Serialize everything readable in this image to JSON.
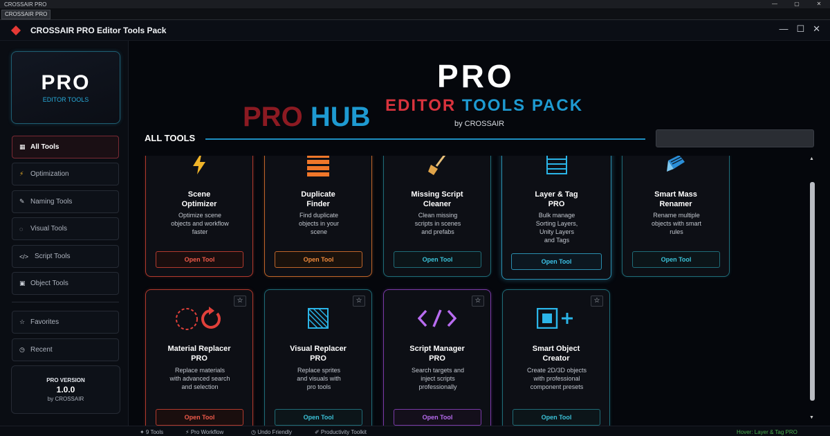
{
  "os": {
    "title": "CROSSAIR PRO",
    "tab": "CROSSAIR PRO",
    "minimize": "—",
    "maximize": "▢",
    "close": "✕"
  },
  "app": {
    "title": "CROSSAIR PRO Editor Tools Pack",
    "minimize": "—",
    "maximize": "☐",
    "close": "✕",
    "accent": "#e53935"
  },
  "sidebar": {
    "logo_big": "PRO",
    "logo_small": "EDITOR TOOLS",
    "items": [
      {
        "icon": "▦",
        "label": "All Tools"
      },
      {
        "icon": "⚡",
        "label": "Optimization"
      },
      {
        "icon": "✎",
        "label": "Naming Tools"
      },
      {
        "icon": "◌",
        "label": "Visual Tools"
      },
      {
        "icon": "</>",
        "label": "Script Tools"
      },
      {
        "icon": "▣",
        "label": "Object Tools"
      }
    ],
    "favorites": {
      "icon": "☆",
      "label": "Favorites"
    },
    "recent": {
      "icon": "◷",
      "label": "Recent"
    },
    "version": {
      "line1": "PRO VERSION",
      "line2": "1.0.0",
      "line3": "by CROSSAIR"
    }
  },
  "hero": {
    "pro": "PRO",
    "hub_left": "PRO",
    "hub_right": "HUB",
    "word1": "EDITOR",
    "word2": "TOOLS",
    "word3": "PACK",
    "by": "by CROSSAIR"
  },
  "main": {
    "section_title": "ALL TOOLS",
    "search_value": ""
  },
  "cards": [
    {
      "title1": "Scene",
      "title2": "Optimizer",
      "desc": [
        "Optimize scene",
        "objects and workflow",
        "faster"
      ],
      "button": "Open Tool",
      "icon": "lightning-icon",
      "theme": "red"
    },
    {
      "title1": "Duplicate",
      "title2": "Finder",
      "desc": [
        "Find duplicate",
        "objects in your",
        "scene"
      ],
      "button": "Open Tool",
      "icon": "stack-icon",
      "theme": "orange"
    },
    {
      "title1": "Missing Script",
      "title2": "Cleaner",
      "desc": [
        "Clean missing",
        "scripts in scenes",
        "and prefabs"
      ],
      "button": "Open Tool",
      "icon": "broom-icon",
      "theme": "teal"
    },
    {
      "title1": "Layer & Tag",
      "title2": "PRO",
      "desc": [
        "Bulk manage",
        "Sorting Layers,",
        "Unity Layers",
        "and Tags"
      ],
      "button": "Open Tool",
      "icon": "layers-icon",
      "theme": "hover"
    },
    {
      "title1": "Smart Mass",
      "title2": "Renamer",
      "desc": [
        "Rename multiple",
        "objects with smart",
        "rules"
      ],
      "button": "Open Tool",
      "icon": "pencil-icon",
      "theme": "teal"
    },
    {
      "title1": "Material Replacer",
      "title2": "PRO",
      "desc": [
        "Replace materials",
        "with advanced search",
        "and selection"
      ],
      "button": "Open Tool",
      "icon": "replace-cycle-icon",
      "theme": "red",
      "star": "☆"
    },
    {
      "title1": "Visual Replacer",
      "title2": "PRO",
      "desc": [
        "Replace sprites",
        "and visuals with",
        "pro tools"
      ],
      "button": "Open Tool",
      "icon": "hatched-square-icon",
      "theme": "teal",
      "star": "☆"
    },
    {
      "title1": "Script Manager",
      "title2": "PRO",
      "desc": [
        "Search targets and",
        "inject scripts",
        "professionally"
      ],
      "button": "Open Tool",
      "icon": "code-icon",
      "theme": "purple",
      "star": "☆"
    },
    {
      "title1": "Smart Object",
      "title2": "Creator",
      "desc": [
        "Create 2D/3D objects",
        "with professional",
        "component presets"
      ],
      "button": "Open Tool",
      "icon": "square-plus-icon",
      "theme": "teal",
      "star": "☆"
    }
  ],
  "status": {
    "s1": "✦ 9 Tools",
    "s2": "⚡ Pro Workflow",
    "s3": "◷ Undo Friendly",
    "s4": "✐ Productivity Toolkit",
    "hover": "Hover: Layer & Tag PRO"
  },
  "scroll": {
    "up": "▲",
    "down": "▼"
  }
}
